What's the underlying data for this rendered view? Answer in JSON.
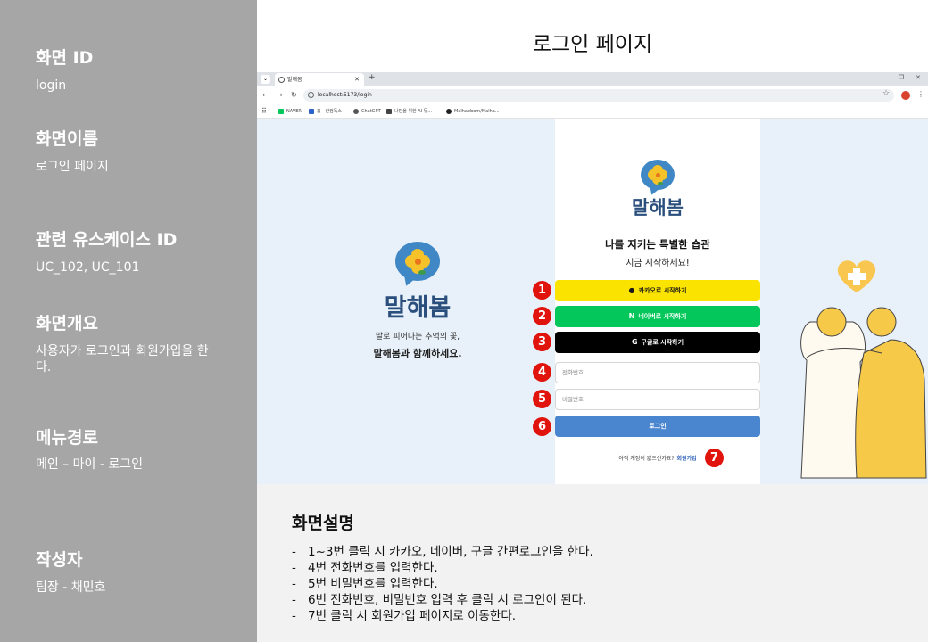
{
  "sidebar": {
    "screen_id_label": "화면 ID",
    "screen_id_value": "login",
    "screen_name_label": "화면이름",
    "screen_name_value": "로그인 페이지",
    "usecase_label": "관련 유스케이스 ID",
    "usecase_value": "UC_102, UC_101",
    "overview_label": "화면개요",
    "overview_value": "사용자가 로그인과 회원가입을 한다.",
    "menu_path_label": "메뉴경로",
    "menu_path_value": "메인 – 마이 - 로그인",
    "author_label": "작성자",
    "author_value": "팀장 - 채민호"
  },
  "doc_title": "로그인 페이지",
  "browser": {
    "tab_title": "말해봄",
    "url": "localhost:5173/login",
    "bookmarks": [
      "NAVER",
      "홈 - 한컴독스",
      "ChatGPT",
      "나만을 위한 AI 뮤...",
      "Malhaebom/Malha..."
    ]
  },
  "brand": {
    "name": "말해봄",
    "tagline1": "말로 피어나는 추억의 꽃,",
    "tagline2": "말해봄과 함께하세요."
  },
  "login_panel": {
    "brand": "말해봄",
    "headline": "나를 지키는 특별한 습관",
    "subheadline": "지금 시작하세요!",
    "kakao_label": "카카오로 시작하기",
    "naver_label": "네이버로 시작하기",
    "google_label": "구글로 시작하기",
    "phone_placeholder": "전화번호",
    "password_placeholder": "비밀번호",
    "login_label": "로그인",
    "no_account_text": "아직 계정이 없으신가요?",
    "signup_label": "회원가입"
  },
  "markers": [
    "1",
    "2",
    "3",
    "4",
    "5",
    "6",
    "7"
  ],
  "description": {
    "title": "화면설명",
    "items": [
      "1~3번 클릭 시 카카오, 네이버, 구글 간편로그인을 한다.",
      "4번 전화번호를 입력한다.",
      "5번 비밀번호를 입력한다.",
      "6번 전화번호, 비밀번호 입력 후 클릭 시 로그인이 된다.",
      "7번 클릭 시 회원가입 페이지로 이동한다."
    ]
  },
  "colors": {
    "sidebar_bg": "#a6a6a6",
    "kakao": "#fbe300",
    "naver": "#03c75a",
    "google": "#000000",
    "login": "#4a86cf",
    "marker": "#e0140c"
  }
}
